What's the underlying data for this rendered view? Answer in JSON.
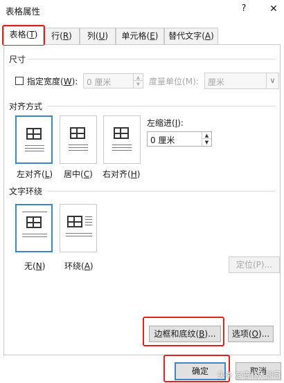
{
  "dialog": {
    "title": "表格属性",
    "help_label": "?",
    "close_label": "✕"
  },
  "tabs": [
    {
      "text": "表格",
      "accel": "T",
      "active": true
    },
    {
      "text": "行",
      "accel": "R",
      "active": false
    },
    {
      "text": "列",
      "accel": "U",
      "active": false
    },
    {
      "text": "单元格",
      "accel": "E",
      "active": false
    },
    {
      "text": "替代文字",
      "accel": "A",
      "active": false
    }
  ],
  "size": {
    "section_title": "尺寸",
    "specify_width": {
      "text": "指定宽度",
      "accel": "W",
      "checked": false
    },
    "width_value": "0 厘米",
    "measure_in": {
      "text": "度量单位",
      "accel": "M"
    },
    "measure_value": "厘米"
  },
  "alignment": {
    "section_title": "对齐方式",
    "options": [
      {
        "text": "左对齐",
        "accel": "L",
        "selected": true
      },
      {
        "text": "居中",
        "accel": "C",
        "selected": false
      },
      {
        "text": "右对齐",
        "accel": "H",
        "selected": false
      }
    ],
    "indent": {
      "text": "左缩进",
      "accel": "I",
      "value": "0 厘米"
    }
  },
  "wrapping": {
    "section_title": "文字环绕",
    "options": [
      {
        "text": "无",
        "accel": "N",
        "selected": true
      },
      {
        "text": "环绕",
        "accel": "A",
        "selected": false
      }
    ],
    "positioning": {
      "text": "定位",
      "accel": "P",
      "ellipsis": "..."
    }
  },
  "buttons": {
    "borders": {
      "text": "边框和底纹",
      "accel": "B",
      "ellipsis": "..."
    },
    "options": {
      "text": "选项",
      "accel": "O",
      "ellipsis": "..."
    },
    "ok": "确定",
    "cancel": "取消"
  },
  "watermark": "头条 @吉林大熊哥"
}
